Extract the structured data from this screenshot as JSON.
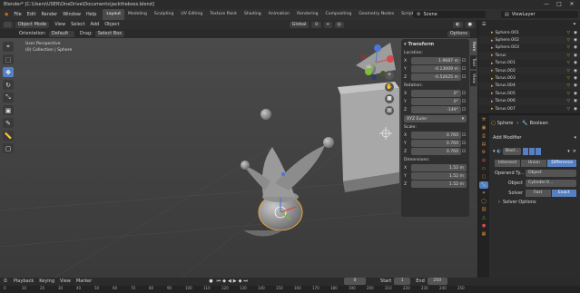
{
  "window": {
    "title": "Blender* [C:\\Users\\USER\\OneDrive\\Documents\\jacktheboss.blend]",
    "controls": [
      "—",
      "□",
      "✕"
    ]
  },
  "menu": {
    "items": [
      "File",
      "Edit",
      "Render",
      "Window",
      "Help"
    ],
    "workspaces": [
      "Layout",
      "Modeling",
      "Sculpting",
      "UV Editing",
      "Texture Paint",
      "Shading",
      "Animation",
      "Rendering",
      "Compositing",
      "Geometry Nodes",
      "Scripting"
    ],
    "active_workspace": "Layout",
    "scene": "Scene",
    "view_layer": "ViewLayer"
  },
  "viewport_header": {
    "mode": "Object Mode",
    "menus": [
      "View",
      "Select",
      "Add",
      "Object"
    ],
    "transform_orientation": "Global"
  },
  "tool_header": {
    "orientation_label": "Orientation:",
    "orientation_value": "Default",
    "drag_label": "Drag:",
    "drag_value": "Select Box",
    "options": "Options"
  },
  "viewport_info": {
    "line1": "User Perspective",
    "line2": "(0) Collection | Sphere"
  },
  "toolbar": {
    "tools": [
      "cursor-icon",
      "select-box-icon",
      "move-icon",
      "rotate-icon",
      "scale-icon",
      "transform-icon",
      "annotate-icon",
      "measure-icon",
      "add-cube-icon"
    ],
    "active_index": 2
  },
  "npanel": {
    "header": "Transform",
    "location_label": "Location:",
    "location": [
      {
        "axis": "X",
        "value": "1.9687 m"
      },
      {
        "axis": "Y",
        "value": "-0.13009 m"
      },
      {
        "axis": "Z",
        "value": "-0.52625 m"
      }
    ],
    "rotation_label": "Rotation:",
    "rotation": [
      {
        "axis": "X",
        "value": "0°"
      },
      {
        "axis": "Y",
        "value": "0°"
      },
      {
        "axis": "Z",
        "value": "-149°"
      }
    ],
    "rotation_mode": "XYZ Euler",
    "scale_label": "Scale:",
    "scale": [
      {
        "axis": "X",
        "value": "0.760"
      },
      {
        "axis": "Y",
        "value": "0.760"
      },
      {
        "axis": "Z",
        "value": "0.760"
      }
    ],
    "dimensions_label": "Dimensions:",
    "dimensions": [
      {
        "axis": "X",
        "value": "1.52 m"
      },
      {
        "axis": "Y",
        "value": "1.52 m"
      },
      {
        "axis": "Z",
        "value": "1.52 m"
      }
    ],
    "tabs": [
      "Item",
      "Tool",
      "View"
    ],
    "active_tab": "Item"
  },
  "outliner": {
    "items": [
      {
        "name": "Sphere.001"
      },
      {
        "name": "Sphere.002"
      },
      {
        "name": "Sphere.003"
      },
      {
        "name": "Torus"
      },
      {
        "name": "Torus.001"
      },
      {
        "name": "Torus.002"
      },
      {
        "name": "Torus.003"
      },
      {
        "name": "Torus.004"
      },
      {
        "name": "Torus.005"
      },
      {
        "name": "Torus.006"
      },
      {
        "name": "Torus.007"
      }
    ]
  },
  "properties": {
    "object_name": "Sphere",
    "modifier_name": "Boolean",
    "add_modifier": "Add Modifier",
    "modifier_short": "Bool...",
    "operations": [
      "Intersect",
      "Union",
      "Difference"
    ],
    "active_operation": "Difference",
    "operand_label": "Operand Ty...",
    "operand_value": "Object",
    "object_label": "Object",
    "object_value": "Cylinder.0...",
    "solver_label": "Solver",
    "solvers": [
      "Fast",
      "Exact"
    ],
    "active_solver": "Exact",
    "solver_options": "Solver Options"
  },
  "timeline": {
    "menus": [
      "Playback",
      "Keying",
      "View",
      "Marker"
    ],
    "current_frame": "0",
    "start_label": "Start",
    "start": "1",
    "end_label": "End",
    "end": "250",
    "ticks": [
      "0",
      "10",
      "20",
      "30",
      "40",
      "50",
      "60",
      "70",
      "80",
      "90",
      "100",
      "110",
      "120",
      "130",
      "140",
      "150",
      "160",
      "170",
      "180",
      "190",
      "200",
      "210",
      "220",
      "230",
      "240",
      "250"
    ]
  },
  "colors": {
    "accent": "#5680c2",
    "axis_x": "#d34b4b",
    "axis_y": "#7dbf3a",
    "axis_z": "#4b78d3",
    "selection_outline": "#e8a33a"
  }
}
